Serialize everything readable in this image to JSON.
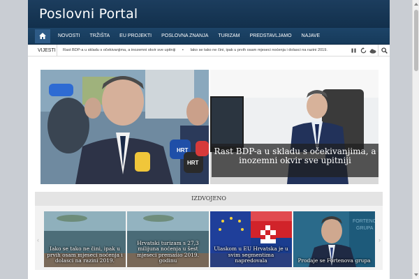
{
  "header": {
    "site_title": "Poslovni Portal"
  },
  "nav": {
    "items": [
      "NOVOSTI",
      "TRŽIŠTA",
      "EU PROJEKTI",
      "POSLOVNA ZNANJA",
      "TURIZAM",
      "PREDSTAVLJAMO",
      "NAJAVE"
    ]
  },
  "ticker": {
    "label": "VIJESTI",
    "headlines": [
      "Rast BDP-a u skladu s očekivanjima, a inozemni okvir sve upitniji",
      "Iako se tako ne čini, ipak u prvih osam mjeseci noćenja i dolasci na razini 2019."
    ]
  },
  "featured": {
    "right_caption": "Rast BDP-a u skladu s očekivanjima, a inozemni okvir sve upitniji"
  },
  "section": {
    "title": "IZDVOJENO"
  },
  "carousel": {
    "prev": "‹",
    "next": "›",
    "tiles": [
      "Iako se tako ne čini, ipak u prvih osam mjeseci noćenja i dolasci na razini 2019.",
      "Hrvatski turizam s 27,3 milijuna noćenja u šest mjeseci premašio 2019. godinu",
      "Ulaskom u EU Hrvatska je u svim segmentima napredovala",
      "Prodaje se Fortenova grupa"
    ]
  },
  "colors": {
    "header": "#1c3d5e",
    "nav": "#1d4468",
    "accent": "#2d5a86"
  }
}
